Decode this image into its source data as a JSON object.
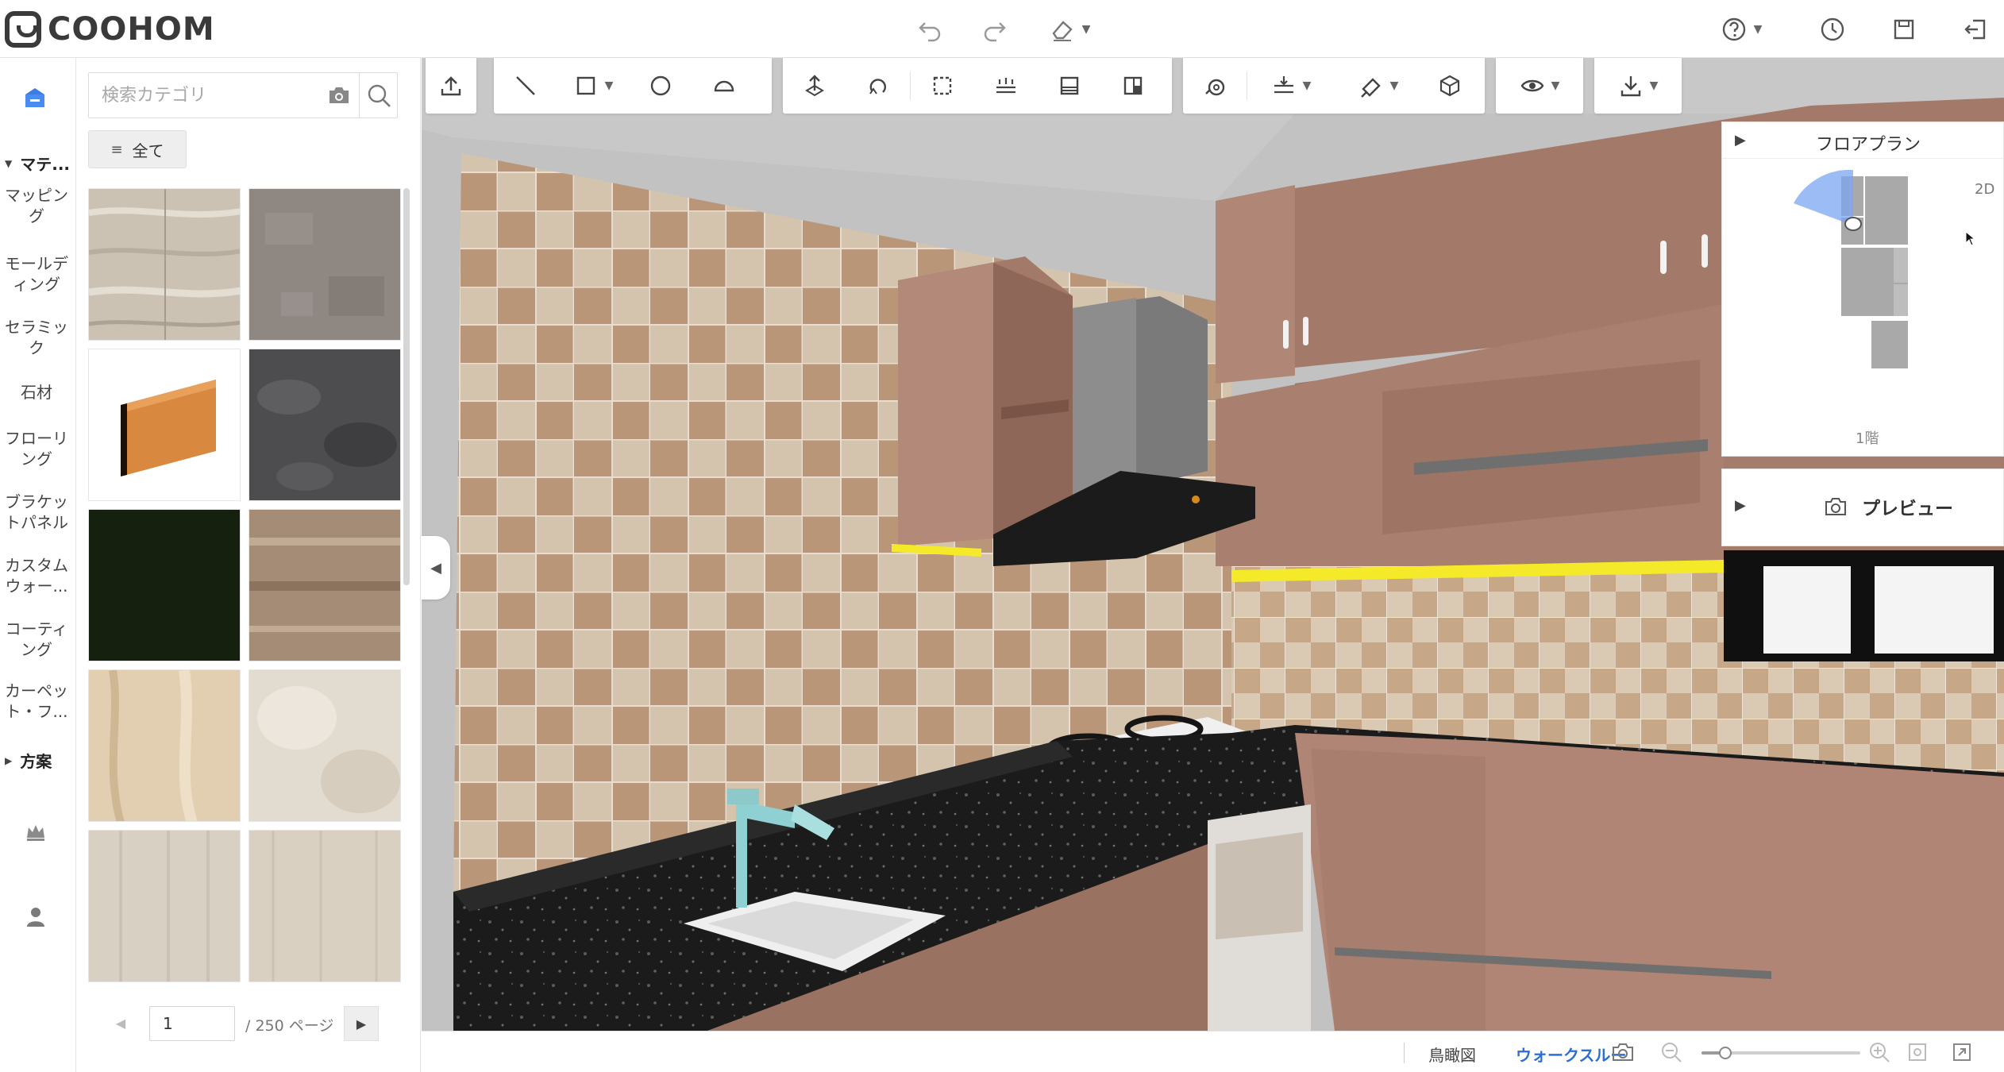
{
  "app": {
    "brand": "COOHOM"
  },
  "rail": {
    "section_materials": "マテ...",
    "categories": [
      {
        "label": "マッピング"
      },
      {
        "label": "モールディング"
      },
      {
        "label": "セラミック"
      },
      {
        "label": "石材"
      },
      {
        "label": "フローリング"
      },
      {
        "label": "ブラケットパネル"
      },
      {
        "label": "カスタムウォー..."
      },
      {
        "label": "コーティング"
      },
      {
        "label": "カーペット・フ..."
      }
    ],
    "section_plans": "方案"
  },
  "panel": {
    "search_placeholder": "検索カテゴリ",
    "filter_all": "全て",
    "tiles": [
      {
        "name": "light-wood-texture",
        "color": "#cfc6b8"
      },
      {
        "name": "gray-carpet-texture",
        "color": "#8d8580"
      },
      {
        "name": "wood-baseboard-molding",
        "color": "#d58a43"
      },
      {
        "name": "dark-stone-texture",
        "color": "#4e4e50"
      },
      {
        "name": "black-green-solid",
        "color": "#15200f"
      },
      {
        "name": "brown-marble-texture",
        "color": "#a38b76"
      },
      {
        "name": "beige-stone-texture",
        "color": "#e3d0b4"
      },
      {
        "name": "cream-stone-texture",
        "color": "#e2dbd0"
      },
      {
        "name": "pale-wood-texture",
        "color": "#d8d0c4"
      },
      {
        "name": "pale-oak-texture",
        "color": "#d9d0c2"
      }
    ],
    "pager": {
      "current": "1",
      "total": "/ 250 ページ"
    }
  },
  "floorplan": {
    "title": "フロアプラン",
    "mode": "2D",
    "floor": "1階"
  },
  "preview": {
    "title": "プレビュー"
  },
  "statusbar": {
    "birdseye": "鳥瞰図",
    "walkthrough": "ウォークスルー",
    "zoom_level": 0.15
  },
  "colors": {
    "accent": "#2a6fd6",
    "toolbar_bg": "#ffffff",
    "led_strip": "#f5ea2a",
    "cabinet": "#a0786a",
    "countertop": "#1a1a1a",
    "tile_light": "#d6c6b0",
    "tile_dark": "#b99678"
  },
  "icons": {
    "undo": "undo-icon",
    "redo": "redo-icon",
    "eraser": "eraser-icon",
    "help": "help-icon",
    "history": "history-icon",
    "save": "save-icon",
    "exit": "exit-icon"
  }
}
